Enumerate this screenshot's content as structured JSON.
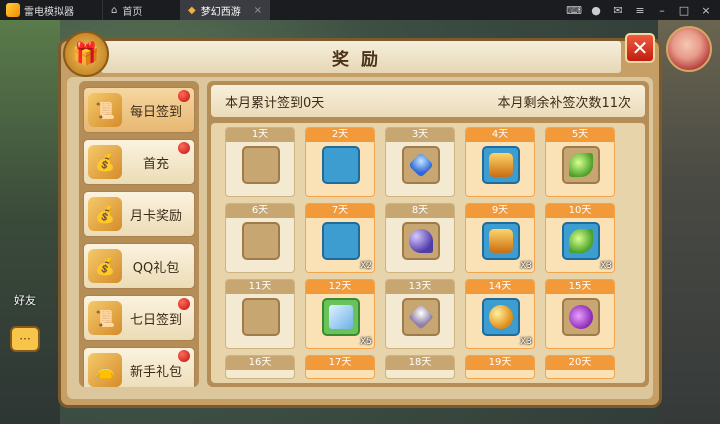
{
  "titlebar": {
    "app_name": "雷电模拟器",
    "home_tab": "首页",
    "game_tab": "梦幻西游",
    "close_tab_glyph": "×"
  },
  "background": {
    "friend_label": "好友",
    "chat_glyph": "···"
  },
  "panel": {
    "title": "奖励",
    "close_glyph": "✕",
    "gift_glyph": "🎁"
  },
  "sidebar": {
    "items": [
      {
        "label": "每日签到",
        "icon": "scroll-icon",
        "glyph": "📜",
        "badge": true,
        "active": true
      },
      {
        "label": "首充",
        "icon": "treasure-chest-icon",
        "glyph": "💰",
        "badge": true,
        "active": false
      },
      {
        "label": "月卡奖励",
        "icon": "treasure-chest-icon",
        "glyph": "💰",
        "badge": false,
        "active": false
      },
      {
        "label": "QQ礼包",
        "icon": "treasure-chest-icon",
        "glyph": "💰",
        "badge": false,
        "active": false
      },
      {
        "label": "七日签到",
        "icon": "scroll-icon",
        "glyph": "📜",
        "badge": true,
        "active": false
      },
      {
        "label": "新手礼包",
        "icon": "gift-bag-icon",
        "glyph": "👝",
        "badge": true,
        "active": false
      }
    ]
  },
  "summary": {
    "month_signed": "本月累计签到0天",
    "makeup_left": "本月剩余补签次数11次"
  },
  "days": [
    {
      "day": "1天",
      "item": "silver-coin",
      "frame": "plain",
      "qty": "",
      "hl": false
    },
    {
      "day": "2天",
      "item": "green-orb",
      "frame": "blue",
      "qty": "",
      "hl": true
    },
    {
      "day": "3天",
      "item": "blue-crystal",
      "frame": "plain",
      "qty": "",
      "hl": false
    },
    {
      "day": "4天",
      "item": "gold-chest",
      "frame": "blue",
      "qty": "",
      "hl": true
    },
    {
      "day": "5天",
      "item": "leaf",
      "frame": "plain",
      "qty": "",
      "hl": true
    },
    {
      "day": "6天",
      "item": "silver-coin",
      "frame": "plain",
      "qty": "",
      "hl": false
    },
    {
      "day": "7天",
      "item": "green-orb",
      "frame": "blue",
      "qty": "X2",
      "hl": true
    },
    {
      "day": "8天",
      "item": "moon",
      "frame": "plain",
      "qty": "",
      "hl": false
    },
    {
      "day": "9天",
      "item": "gold-chest",
      "frame": "blue",
      "qty": "X3",
      "hl": true
    },
    {
      "day": "10天",
      "item": "leaf",
      "frame": "blue",
      "qty": "X3",
      "hl": true
    },
    {
      "day": "11天",
      "item": "silver-coin",
      "frame": "plain",
      "qty": "",
      "hl": false
    },
    {
      "day": "12天",
      "item": "scroll",
      "frame": "green",
      "qty": "X5",
      "hl": true
    },
    {
      "day": "13天",
      "item": "gem",
      "frame": "plain",
      "qty": "",
      "hl": false
    },
    {
      "day": "14天",
      "item": "gold-orb",
      "frame": "blue",
      "qty": "X3",
      "hl": true
    },
    {
      "day": "15天",
      "item": "purple-bag",
      "frame": "plain",
      "qty": "",
      "hl": true
    },
    {
      "day": "16天",
      "item": "",
      "frame": "plain",
      "qty": "",
      "hl": false
    },
    {
      "day": "17天",
      "item": "",
      "frame": "plain",
      "qty": "",
      "hl": true
    },
    {
      "day": "18天",
      "item": "",
      "frame": "plain",
      "qty": "",
      "hl": false
    },
    {
      "day": "19天",
      "item": "",
      "frame": "plain",
      "qty": "",
      "hl": true
    },
    {
      "day": "20天",
      "item": "",
      "frame": "plain",
      "qty": "",
      "hl": true
    }
  ],
  "colors": {
    "panel": "#c59f66",
    "highlight": "#f29a3a",
    "badge": "#c01010",
    "close": "#c01e10"
  }
}
